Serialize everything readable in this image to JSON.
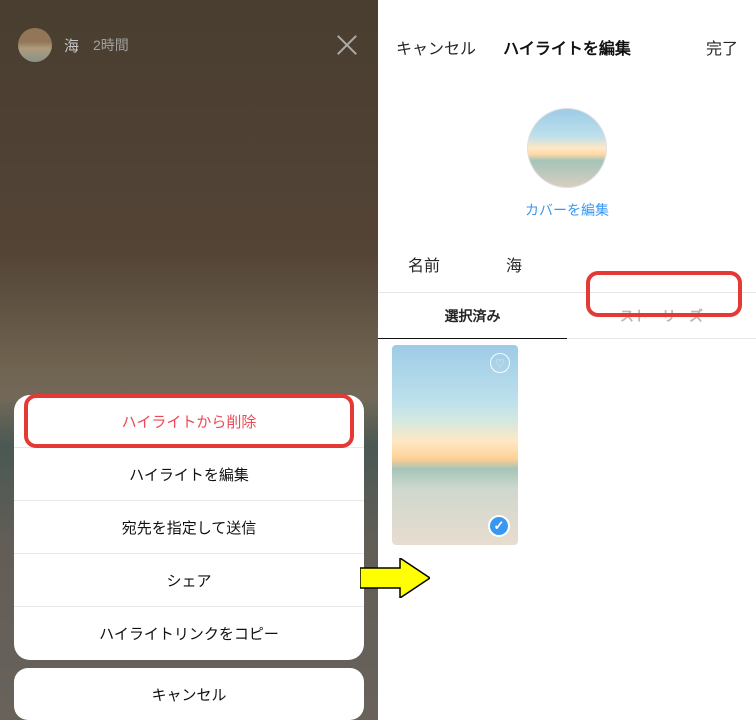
{
  "left": {
    "header": {
      "title": "海",
      "time": "2時間"
    },
    "actions": {
      "remove": "ハイライトから削除",
      "edit": "ハイライトを編集",
      "send": "宛先を指定して送信",
      "share": "シェア",
      "copy_link": "ハイライトリンクをコピー"
    },
    "cancel": "キャンセル"
  },
  "right": {
    "nav": {
      "cancel": "キャンセル",
      "title": "ハイライトを編集",
      "done": "完了"
    },
    "cover": {
      "edit_label": "カバーを編集"
    },
    "name": {
      "label": "名前",
      "value": "海"
    },
    "tabs": {
      "selected": "選択済み",
      "stories": "ストーリーズ"
    }
  }
}
